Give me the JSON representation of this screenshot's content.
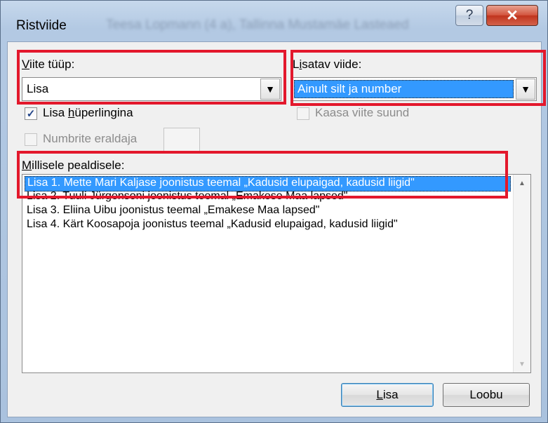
{
  "window": {
    "title": "Ristviide",
    "blurred_title": "Teesa Lopmann (4 a), Tallinna Mustamäe Lasteaed",
    "help_glyph": "?",
    "close_glyph": "✕"
  },
  "reference_type": {
    "label_first": "V",
    "label_rest": "iite tüüp:",
    "value": "Lisa"
  },
  "insert_reference": {
    "label_first": "L",
    "label_underline": "i",
    "label_rest": "satav viide:",
    "value": "Ainult silt ja number"
  },
  "insert_as_hyperlink": {
    "label_pre": "Lisa ",
    "label_underline": "h",
    "label_rest": "üperlingina",
    "checked": true
  },
  "include_above_below": {
    "label": "Kaasa viite suund",
    "checked": false,
    "disabled": true
  },
  "separate_numbers": {
    "label": "Numbrite eraldaja",
    "checked": false,
    "disabled": true
  },
  "caption_list": {
    "label_underline": "M",
    "label_rest": "illisele pealdisele:",
    "items": [
      "Lisa 1. Mette Mari Kaljase joonistus teemal „Kadusid elupaigad, kadusid liigid\"",
      "Lisa 2. Tuuli Jürgensoni joonistus teemal „Emakese Maa lapsed\"",
      "Lisa 3. Eliina Uibu joonistus teemal „Emakese Maa lapsed\"",
      "Lisa 4. Kärt Koosapoja joonistus teemal „Kadusid elupaigad, kadusid liigid\""
    ],
    "selected_index": 0
  },
  "buttons": {
    "insert_underline": "L",
    "insert_rest": "isa",
    "cancel": "Loobu"
  },
  "colors": {
    "highlight": "#e3182c",
    "selection": "#3399ff"
  }
}
